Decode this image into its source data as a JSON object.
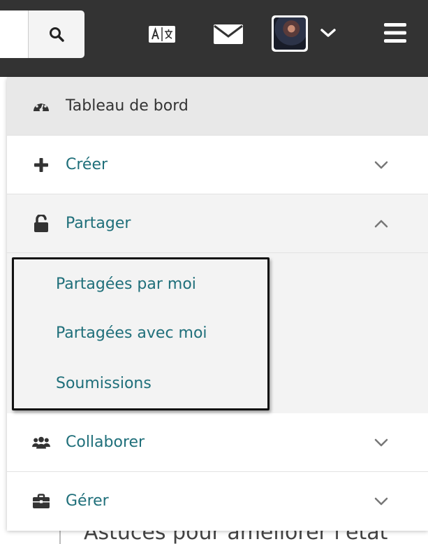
{
  "header": {
    "search_icon": "search-icon",
    "translate_icon": "translate-icon",
    "mail_icon": "mail-icon",
    "avatar_chevron_icon": "chevron-down-icon",
    "menu_icon": "hamburger-icon",
    "bar_color": "#333333"
  },
  "menu": {
    "dashboard": {
      "label": "Tableau de bord",
      "icon": "dashboard-gauge-icon"
    },
    "create": {
      "label": "Créer",
      "icon": "plus-icon",
      "chevron": "chevron-down-icon"
    },
    "share": {
      "label": "Partager",
      "icon": "unlock-icon",
      "chevron": "chevron-up-icon",
      "subitems": [
        {
          "label": "Partagées par moi"
        },
        {
          "label": "Partagées avec moi"
        },
        {
          "label": "Soumissions"
        }
      ]
    },
    "collaborate": {
      "label": "Collaborer",
      "icon": "users-icon",
      "chevron": "chevron-down-icon"
    },
    "manage": {
      "label": "Gérer",
      "icon": "briefcase-icon",
      "chevron": "chevron-down-icon"
    },
    "accent_color": "#1f6f7a"
  },
  "background": {
    "partial_text": "Astuces pour améliorer l'état"
  }
}
